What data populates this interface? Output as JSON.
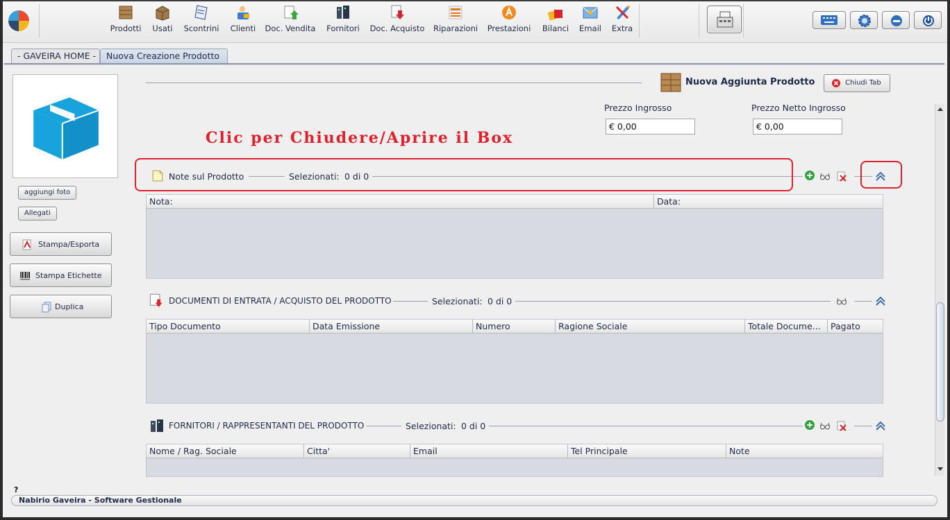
{
  "toolbar": {
    "items": [
      {
        "label": "Prodotti",
        "icon": "box-icon"
      },
      {
        "label": "Usati",
        "icon": "used-box-icon"
      },
      {
        "label": "Scontrini",
        "icon": "receipt-icon"
      },
      {
        "label": "Clienti",
        "icon": "customer-icon"
      },
      {
        "label": "Doc. Vendita",
        "icon": "sales-doc-icon"
      },
      {
        "label": "Fornitori",
        "icon": "supplier-icon"
      },
      {
        "label": "Doc. Acquisto",
        "icon": "purchase-doc-icon"
      },
      {
        "label": "Riparazioni",
        "icon": "repair-icon"
      },
      {
        "label": "Prestazioni",
        "icon": "service-icon"
      },
      {
        "label": "Bilanci",
        "icon": "balance-icon"
      },
      {
        "label": "Email",
        "icon": "email-icon"
      },
      {
        "label": "Extra",
        "icon": "extra-tools-icon"
      }
    ]
  },
  "tabs": [
    {
      "label": "- GAVEIRA HOME -"
    },
    {
      "label": "Nuova Creazione Prodotto"
    }
  ],
  "left": {
    "add_photo": "aggiungi foto",
    "attachments": "Allegati",
    "print_export": "Stampa/Esporta",
    "print_labels": "Stampa Etichette",
    "duplicate": "Duplica"
  },
  "header": {
    "title": "Nuova Aggiunta Prodotto",
    "close_tab": "Chiudi Tab"
  },
  "prices": {
    "wholesale_label": "Prezzo Ingrosso",
    "wholesale_value": "€ 0,00",
    "net_wholesale_label": "Prezzo Netto Ingrosso",
    "net_wholesale_value": "€ 0,00"
  },
  "annotation": "Clic per Chiudere/Aprire il Box",
  "notes_section": {
    "title": "Note sul Prodotto",
    "selected_label": "Selezionati:",
    "selected_value": "0 di 0",
    "columns": [
      "Nota:",
      "Data:"
    ]
  },
  "docs_section": {
    "title": "DOCUMENTI DI ENTRATA / ACQUISTO DEL PRODOTTO",
    "selected_label": "Selezionati:",
    "selected_value": "0 di 0",
    "columns": [
      "Tipo Documento",
      "Data Emissione",
      "Numero",
      "Ragione Sociale",
      "Totale Docume...",
      "Pagato"
    ]
  },
  "suppliers_section": {
    "title": "FORNITORI / RAPPRESENTANTI DEL PRODOTTO",
    "selected_label": "Selezionati:",
    "selected_value": "0 di 0",
    "columns": [
      "Nome / Rag. Sociale",
      "Citta'",
      "Email",
      "Tel Principale",
      "Note"
    ]
  },
  "help": "?",
  "status": "Nabirio Gaveira - Software Gestionale",
  "colors": {
    "accent": "#e0202a",
    "product_box": "#1aa0d8",
    "header_blue": "#1f2a4a"
  }
}
